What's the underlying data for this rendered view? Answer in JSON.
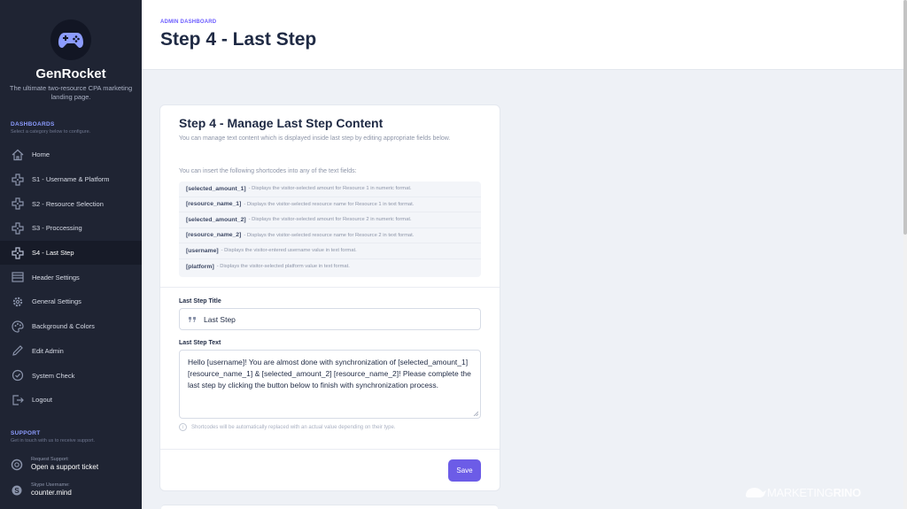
{
  "sidebar": {
    "brand": "GenRocket",
    "tagline": "The ultimate two-resource CPA marketing landing page.",
    "dashboards_title": "DASHBOARDS",
    "dashboards_sub": "Select a category below to configure.",
    "items": [
      {
        "label": "Home",
        "icon": "home-icon"
      },
      {
        "label": "S1 - Username & Platform",
        "icon": "gamepad-icon"
      },
      {
        "label": "S2 - Resource Selection",
        "icon": "gamepad-icon"
      },
      {
        "label": "S3 - Proccessing",
        "icon": "gamepad-icon"
      },
      {
        "label": "S4 - Last Step",
        "icon": "gamepad-icon",
        "active": true
      },
      {
        "label": "Header Settings",
        "icon": "header-icon"
      },
      {
        "label": "General Settings",
        "icon": "gear-icon"
      },
      {
        "label": "Background & Colors",
        "icon": "palette-icon"
      },
      {
        "label": "Edit Admin",
        "icon": "pencil-icon"
      },
      {
        "label": "System Check",
        "icon": "check-circle-icon"
      },
      {
        "label": "Logout",
        "icon": "logout-icon"
      }
    ],
    "support_title": "SUPPORT",
    "support_sub": "Get in touch with us to receive support.",
    "request_small": "Request Support:",
    "request_big": "Open a support ticket",
    "skype_small": "Skype Username:",
    "skype_big": "counter.mind"
  },
  "header": {
    "small": "ADMIN DASHBOARD",
    "title": "Step 4 - Last Step"
  },
  "card": {
    "title": "Step 4 - Manage Last Step Content",
    "description": "You can manage text content which is displayed inside last step by editing appropriate fields below.",
    "shortcodes_intro": "You can insert the following shortcodes into any of the text fields:",
    "shortcodes": [
      {
        "code": "[selected_amount_1]",
        "desc": "- Displays the visitor-selected amount for Resource 1 in numeric format."
      },
      {
        "code": "[resource_name_1]",
        "desc": "- Displays the visitor-selected resource name for Resource 1 in text format."
      },
      {
        "code": "[selected_amount_2]",
        "desc": "- Displays the visitor-selected amount for Resource 2 in numeric format."
      },
      {
        "code": "[resource_name_2]",
        "desc": "- Displays the visitor-selected resource name for Resource 2 in text format."
      },
      {
        "code": "[username]",
        "desc": "- Displays the visitor-entered username value in text format."
      },
      {
        "code": "[platform]",
        "desc": "- Displays the visitor-selected platform value in text format."
      }
    ],
    "title_label": "Last Step Title",
    "title_value": "Last Step",
    "text_label": "Last Step Text",
    "text_value": "Hello [username]! You are almost done with synchronization of [selected_amount_1] [resource_name_1] & [selected_amount_2] [resource_name_2]! Please complete the last step by clicking the button below to finish with synchronization process.",
    "hint": "Shortcodes will be automatically replaced with an actual value depending on their type.",
    "save_label": "Save"
  },
  "watermark": {
    "part1": "MARKETING",
    "part2": "RINO"
  },
  "colors": {
    "accent": "#6c5ce7",
    "sidebar_bg": "#1f2433",
    "page_bg": "#eef1f6"
  }
}
